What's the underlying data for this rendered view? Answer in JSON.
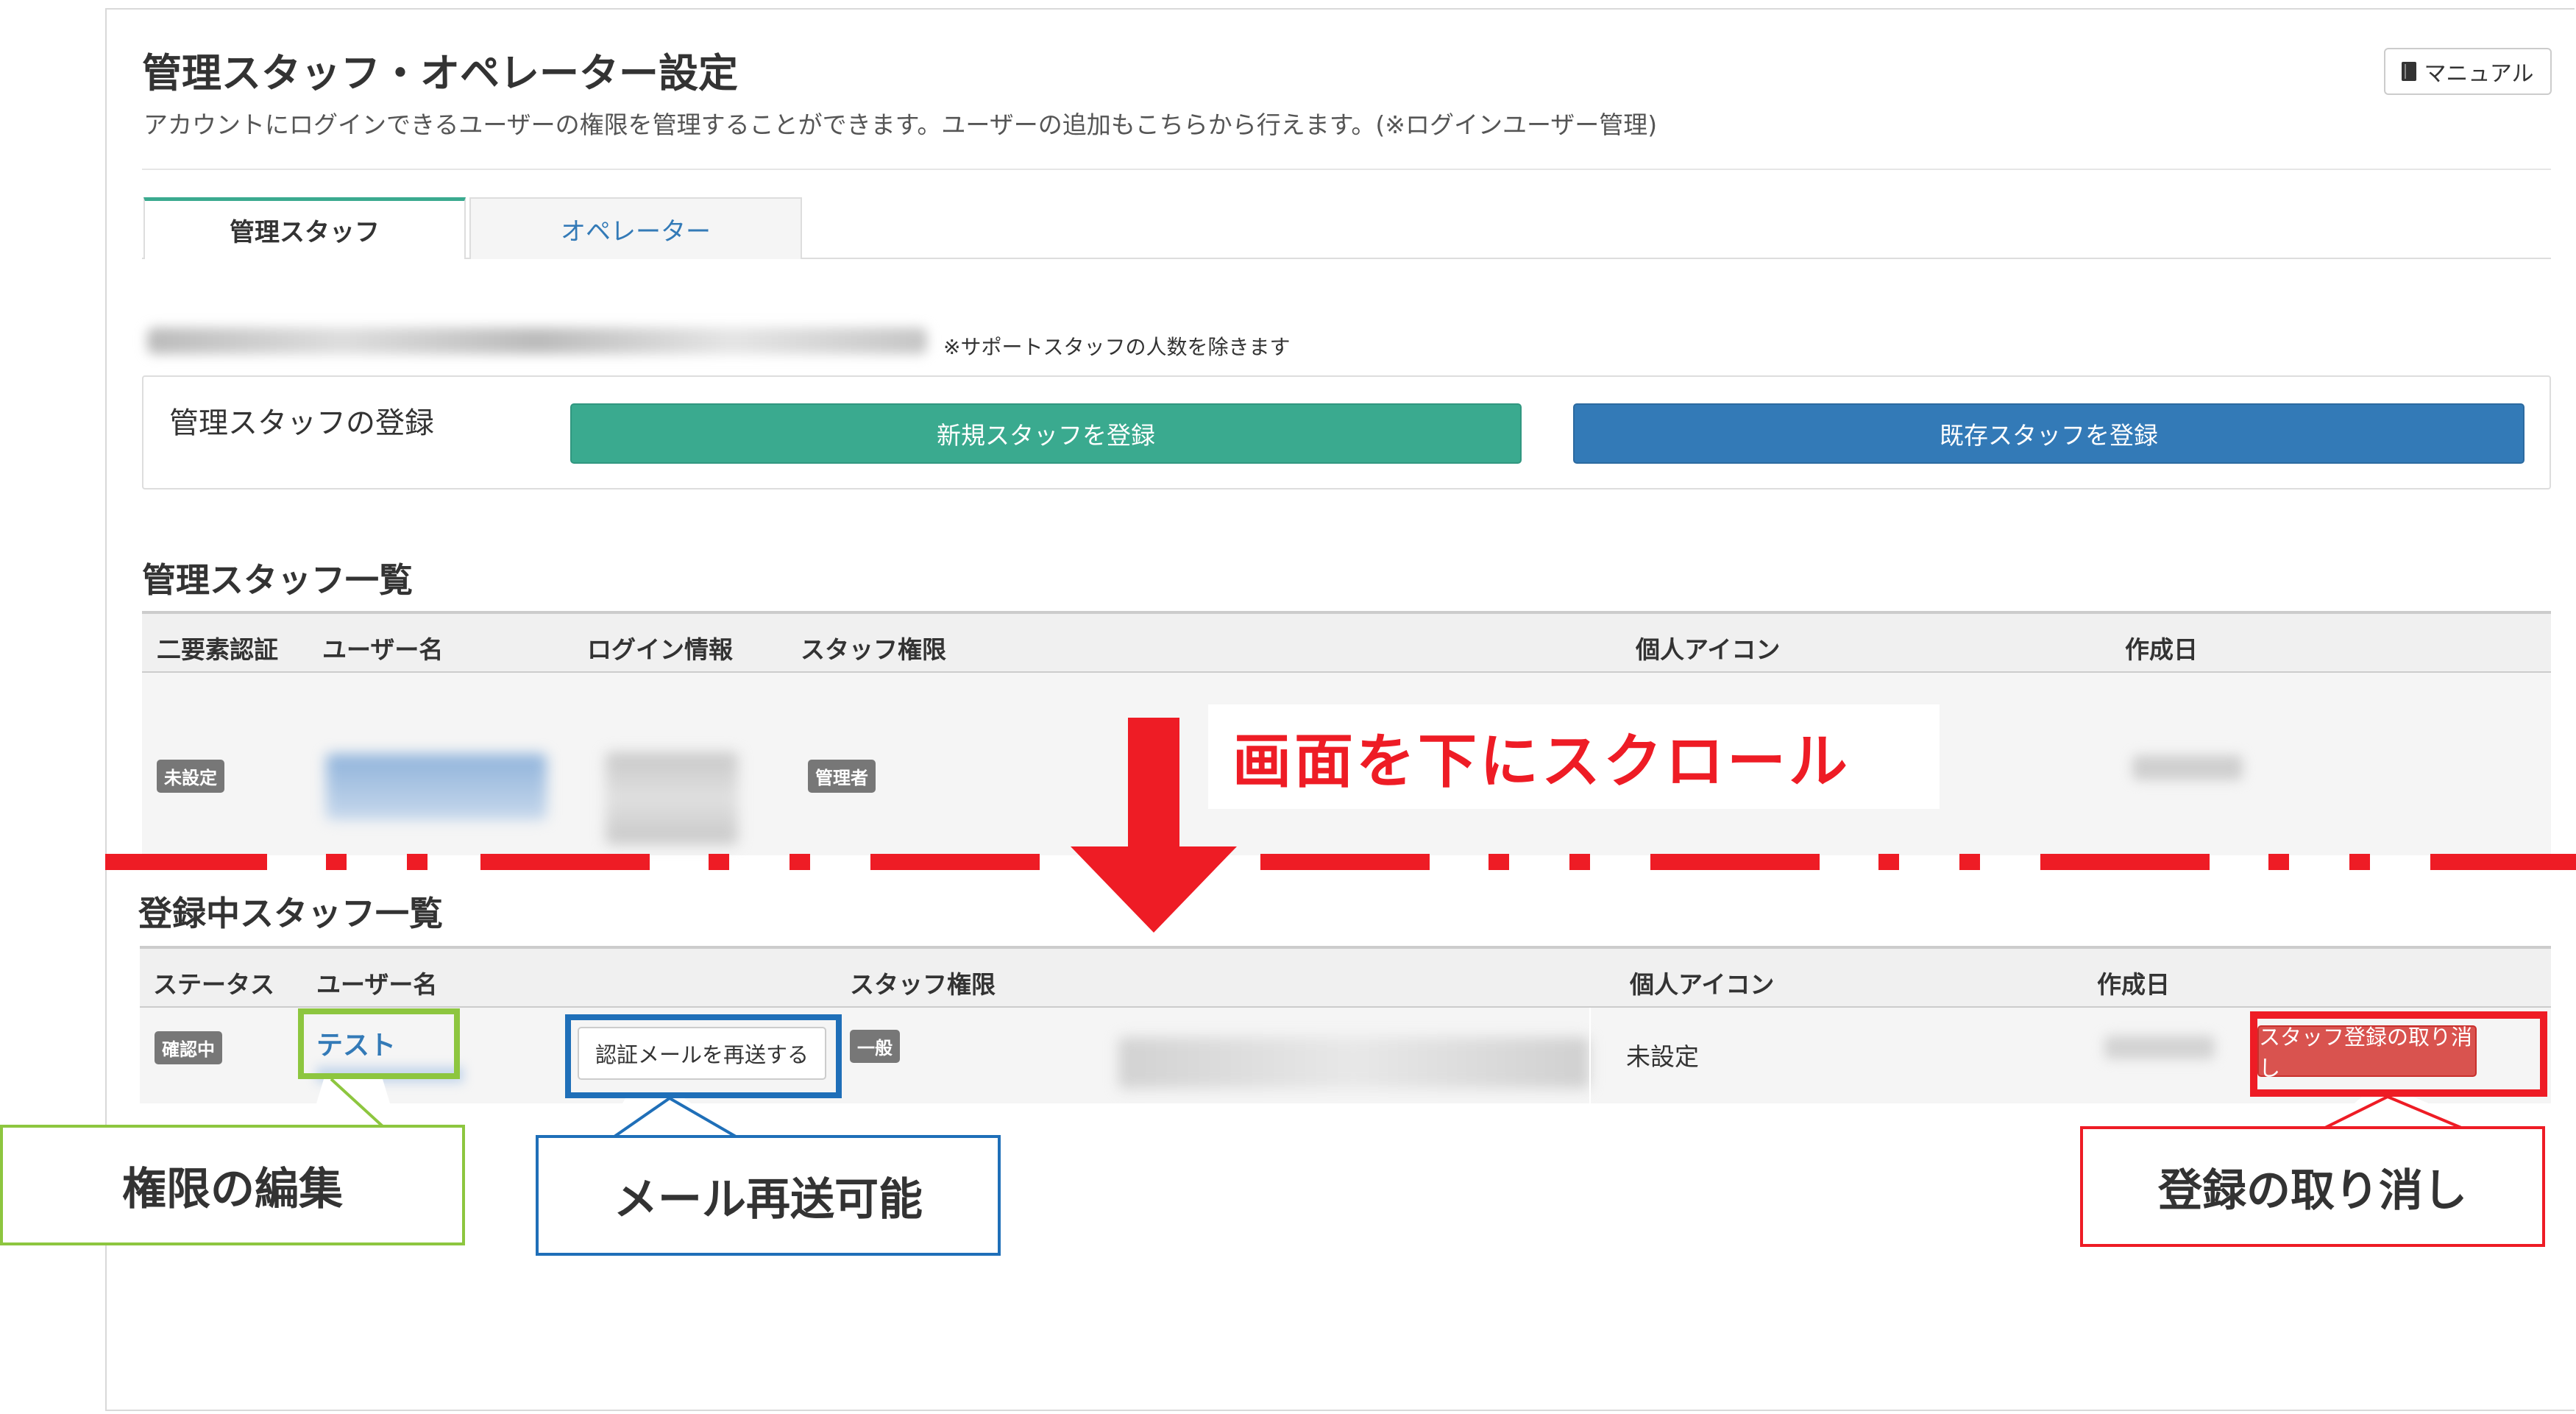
{
  "header": {
    "title": "管理スタッフ・オペレーター設定",
    "description": "アカウントにログインできるユーザーの権限を管理することができます。ユーザーの追加もこちらから行えます。(※ログインユーザー管理)",
    "manual_button": "マニュアル",
    "manual_icon": "book-icon"
  },
  "tabs": [
    {
      "label": "管理スタッフ",
      "active": true
    },
    {
      "label": "オペレーター",
      "active": false
    }
  ],
  "staff_count_note": "※サポートスタッフの人数を除きます",
  "registration": {
    "label": "管理スタッフの登録",
    "new_button": "新規スタッフを登録",
    "existing_button": "既存スタッフを登録"
  },
  "staff_list": {
    "title": "管理スタッフ一覧",
    "columns": [
      "二要素認証",
      "ユーザー名",
      "ログイン情報",
      "スタッフ権限",
      "個人アイコン",
      "作成日"
    ],
    "row": {
      "two_factor": "未設定",
      "role": "管理者"
    }
  },
  "registering_list": {
    "title": "登録中スタッフ一覧",
    "columns": [
      "ステータス",
      "ユーザー名",
      "スタッフ権限",
      "個人アイコン",
      "作成日"
    ],
    "row": {
      "status": "確認中",
      "username": "テスト",
      "resend_button": "認証メールを再送する",
      "role": "一般",
      "icon": "未設定",
      "cancel_button": "スタッフ登録の取り消し"
    }
  },
  "annotations": {
    "scroll": "画面を下にスクロール",
    "edit_permission": "権限の編集",
    "resend_mail": "メール再送可能",
    "cancel_registration": "登録の取り消し",
    "colors": {
      "red": "#ee1c25",
      "green": "#8dc63f",
      "blue": "#1f6fb8"
    }
  }
}
